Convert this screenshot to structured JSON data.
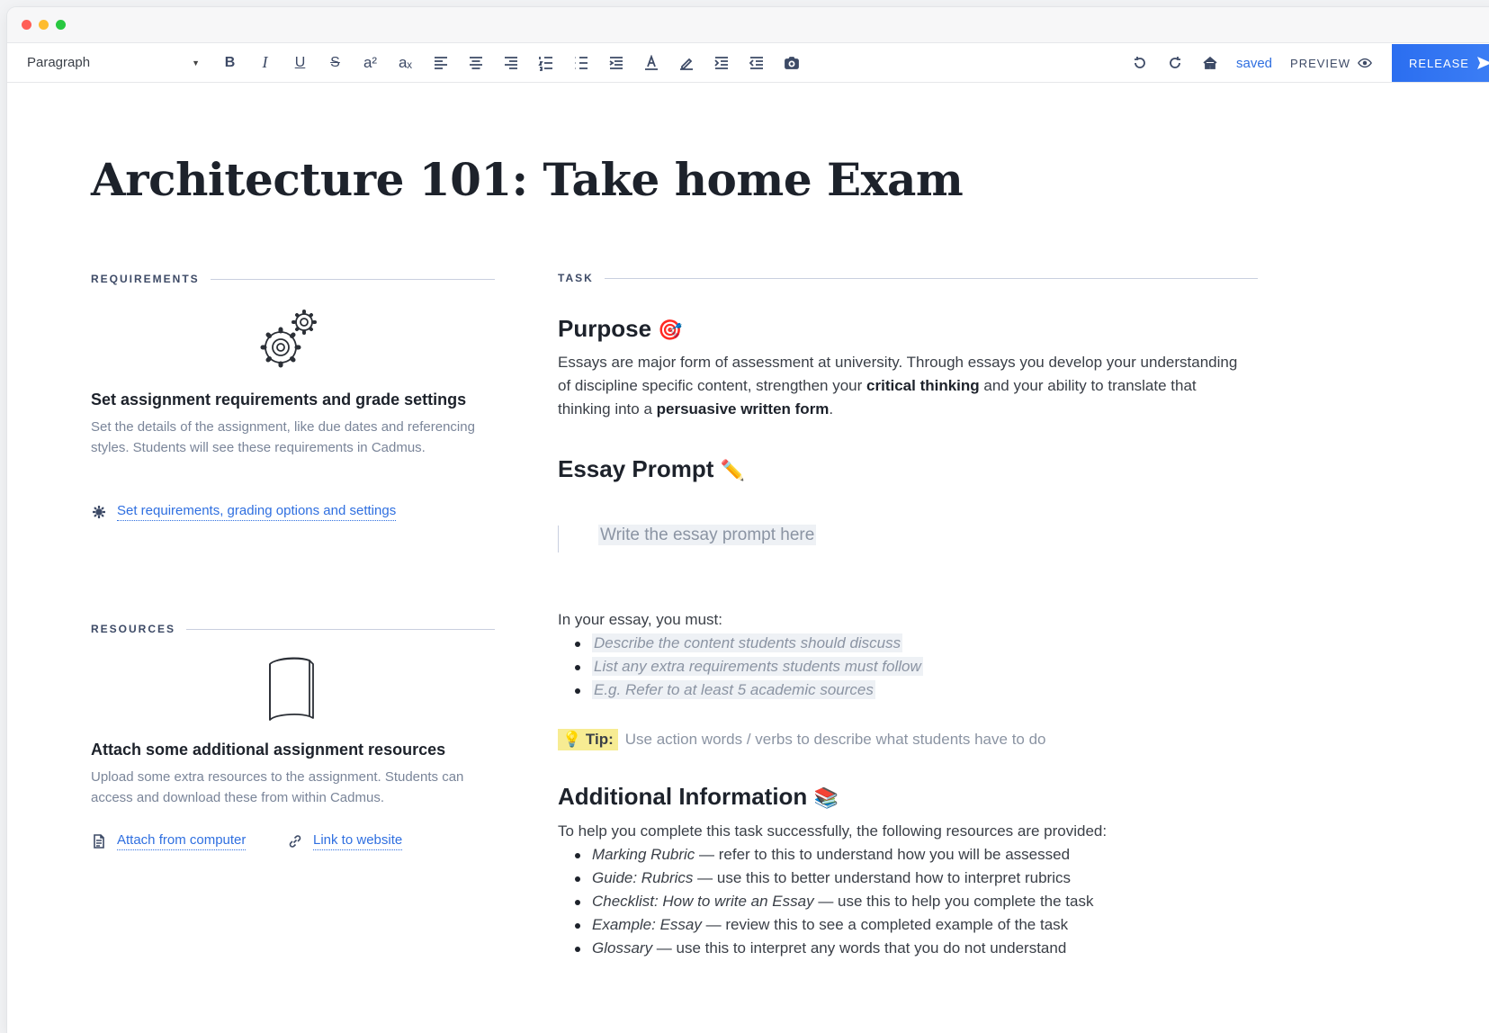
{
  "toolbar": {
    "paragraph_style": "Paragraph",
    "bold": "B",
    "italic": "I",
    "underline": "U",
    "strike": "S",
    "superscript": "a²",
    "subscript": "aₓ",
    "saved": "saved",
    "preview": "PREVIEW",
    "release": "RELEASE"
  },
  "page": {
    "title": "Architecture 101: Take home Exam"
  },
  "requirements": {
    "label": "REQUIREMENTS",
    "title": "Set assignment requirements and grade settings",
    "description": "Set the details of the assignment, like due dates and referencing styles. Students will see these requirements in Cadmus.",
    "link": "Set requirements, grading options and settings"
  },
  "resources": {
    "label": "RESOURCES",
    "title": "Attach some additional assignment resources",
    "description": "Upload some extra resources to the assignment. Students can access and download these from within Cadmus.",
    "attach_link": "Attach from computer",
    "website_link": "Link to website"
  },
  "task": {
    "label": "TASK",
    "purpose_heading": "Purpose",
    "purpose_emoji": "🎯",
    "purpose_text_1": "Essays are major form of assessment at university. Through essays you develop your understanding of discipline specific content, strengthen your ",
    "purpose_bold_1": "critical thinking",
    "purpose_text_2": " and your ability to translate that thinking into a ",
    "purpose_bold_2": "persuasive written form",
    "purpose_text_3": ".",
    "prompt_heading": "Essay Prompt",
    "prompt_emoji": "✏️",
    "prompt_placeholder": "Write the essay prompt here",
    "must_intro": "In your essay, you must:",
    "must_items": [
      "Describe the content students should discuss",
      "List any extra requirements students must follow",
      "E.g. Refer to at least 5 academic sources"
    ],
    "tip_label": "💡 Tip:",
    "tip_text": "Use action words / verbs to describe what students have to do",
    "additional_heading": "Additional Information",
    "additional_emoji": "📚",
    "additional_intro": "To help you complete this task successfully, the following resources are provided:",
    "resources": [
      {
        "name": "Marking Rubric",
        "text": " — refer to this to understand how you will be assessed"
      },
      {
        "name": "Guide: Rubrics",
        "text": " — use this to better understand how to interpret rubrics"
      },
      {
        "name": "Checklist: How to write an Essay",
        "text": " — use this to help you complete the task"
      },
      {
        "name": "Example: Essay",
        "text": " — review this to see a completed example of the task"
      },
      {
        "name": "Glossary",
        "text": " — use this to interpret any words that you do not understand"
      }
    ]
  }
}
